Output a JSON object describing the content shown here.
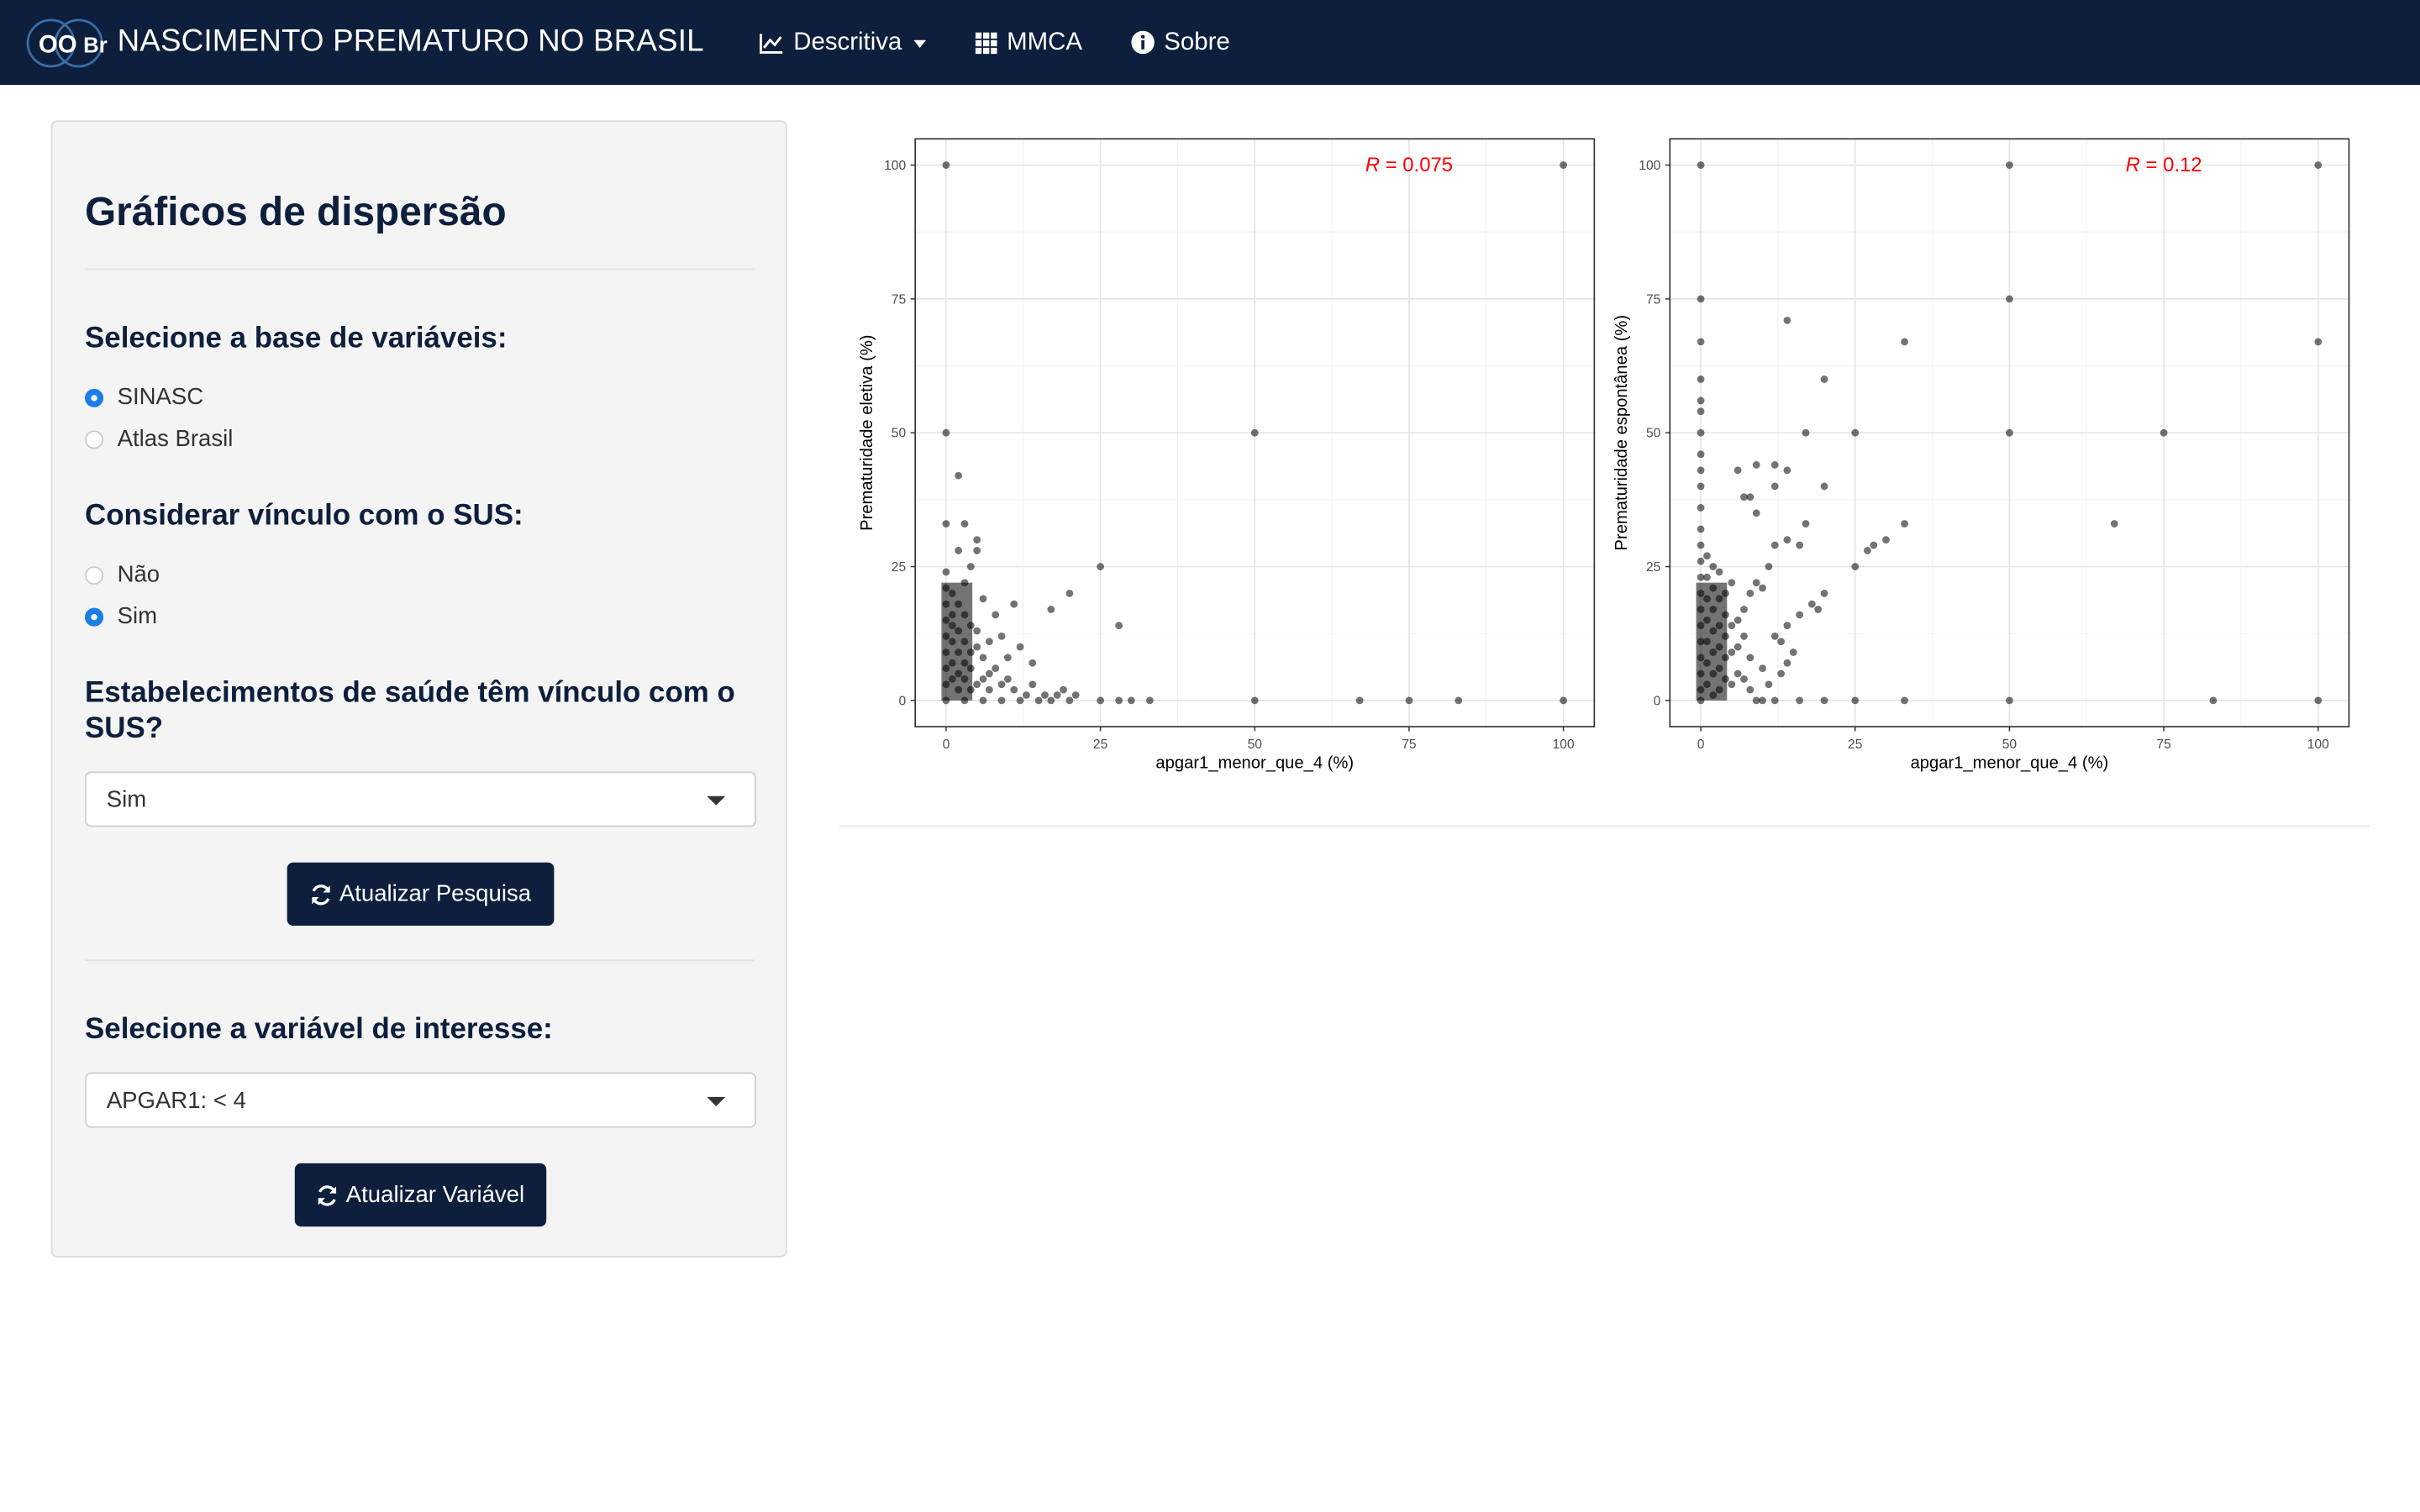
{
  "navbar": {
    "logo_text": "OOBr",
    "title": "NASCIMENTO PREMATURO NO BRASIL",
    "items": [
      {
        "label": "Descritiva",
        "icon": "line-chart-icon",
        "dropdown": true
      },
      {
        "label": "MMCA",
        "icon": "grid-icon",
        "dropdown": false
      },
      {
        "label": "Sobre",
        "icon": "info-circle-icon",
        "dropdown": false
      }
    ]
  },
  "sidebar": {
    "title": "Gráficos de dispersão",
    "base_label": "Selecione a base de variáveis:",
    "base_options": [
      {
        "label": "SINASC",
        "selected": true
      },
      {
        "label": "Atlas Brasil",
        "selected": false
      }
    ],
    "sus_label": "Considerar vínculo com o SUS:",
    "sus_options": [
      {
        "label": "Não",
        "selected": false
      },
      {
        "label": "Sim",
        "selected": true
      }
    ],
    "estab_label": "Estabelecimentos de saúde têm vínculo com o SUS?",
    "estab_value": "Sim",
    "update_search_label": "Atualizar Pesquisa",
    "variable_label": "Selecione a variável de interesse:",
    "variable_value": "APGAR1: < 4",
    "update_variable_label": "Atualizar Variável"
  },
  "colors": {
    "navbar_bg": "#0d1f3c",
    "button_bg": "#0d1f3c",
    "radio_selected": "#1a7ee6",
    "annotation": "#ff0000"
  },
  "chart_data": [
    {
      "type": "scatter",
      "xlabel": "apgar1_menor_que_4 (%)",
      "ylabel": "Prematuridade eletiva (%)",
      "xlim": [
        0,
        100
      ],
      "ylim": [
        0,
        100
      ],
      "xticks": [
        0,
        25,
        50,
        75,
        100
      ],
      "yticks": [
        0,
        25,
        50,
        75,
        100
      ],
      "annotation": {
        "var": "R",
        "text": " = 0.075"
      },
      "grid": true,
      "points": [
        [
          0,
          100
        ],
        [
          100,
          100
        ],
        [
          0,
          50
        ],
        [
          50,
          50
        ],
        [
          0,
          33
        ],
        [
          5,
          30
        ],
        [
          5,
          28
        ],
        [
          2,
          42
        ],
        [
          3,
          33
        ],
        [
          2,
          28
        ],
        [
          25,
          25
        ],
        [
          20,
          20
        ],
        [
          17,
          17
        ],
        [
          28,
          14
        ],
        [
          4,
          25
        ],
        [
          3,
          22
        ],
        [
          6,
          19
        ],
        [
          8,
          16
        ],
        [
          11,
          18
        ],
        [
          9,
          12
        ],
        [
          12,
          10
        ],
        [
          14,
          7
        ],
        [
          19,
          2
        ],
        [
          7,
          5
        ],
        [
          10,
          4
        ],
        [
          5,
          13
        ],
        [
          4,
          9
        ],
        [
          1,
          14
        ],
        [
          0,
          0
        ],
        [
          3,
          0
        ],
        [
          6,
          0
        ],
        [
          9,
          0
        ],
        [
          12,
          0
        ],
        [
          15,
          0
        ],
        [
          17,
          0
        ],
        [
          20,
          0
        ],
        [
          25,
          0
        ],
        [
          28,
          0
        ],
        [
          30,
          0
        ],
        [
          33,
          0
        ],
        [
          50,
          0
        ],
        [
          67,
          0
        ],
        [
          75,
          0
        ],
        [
          83,
          0
        ],
        [
          100,
          0
        ],
        [
          0,
          24
        ],
        [
          0,
          21
        ],
        [
          0,
          18
        ],
        [
          0,
          15
        ],
        [
          0,
          12
        ],
        [
          0,
          9
        ],
        [
          0,
          6
        ],
        [
          0,
          3
        ],
        [
          1,
          20
        ],
        [
          1,
          16
        ],
        [
          1,
          11
        ],
        [
          1,
          7
        ],
        [
          1,
          4
        ],
        [
          2,
          18
        ],
        [
          2,
          13
        ],
        [
          2,
          9
        ],
        [
          2,
          5
        ],
        [
          2,
          2
        ],
        [
          3,
          16
        ],
        [
          3,
          11
        ],
        [
          3,
          7
        ],
        [
          3,
          4
        ],
        [
          4,
          14
        ],
        [
          4,
          6
        ],
        [
          4,
          2
        ],
        [
          5,
          10
        ],
        [
          5,
          3
        ],
        [
          6,
          8
        ],
        [
          6,
          4
        ],
        [
          7,
          11
        ],
        [
          7,
          2
        ],
        [
          8,
          6
        ],
        [
          9,
          3
        ],
        [
          10,
          8
        ],
        [
          11,
          2
        ],
        [
          13,
          1
        ],
        [
          14,
          3
        ],
        [
          16,
          1
        ],
        [
          18,
          1
        ],
        [
          21,
          1
        ]
      ]
    },
    {
      "type": "scatter",
      "xlabel": "apgar1_menor_que_4 (%)",
      "ylabel": "Prematuridade espontânea (%)",
      "xlim": [
        0,
        100
      ],
      "ylim": [
        0,
        100
      ],
      "xticks": [
        0,
        25,
        50,
        75,
        100
      ],
      "yticks": [
        0,
        25,
        50,
        75,
        100
      ],
      "annotation": {
        "var": "R",
        "text": " = 0.12"
      },
      "grid": true,
      "points": [
        [
          0,
          100
        ],
        [
          50,
          100
        ],
        [
          100,
          100
        ],
        [
          0,
          75
        ],
        [
          50,
          75
        ],
        [
          0,
          67
        ],
        [
          33,
          67
        ],
        [
          100,
          67
        ],
        [
          14,
          71
        ],
        [
          20,
          60
        ],
        [
          0,
          60
        ],
        [
          0,
          56
        ],
        [
          0,
          54
        ],
        [
          17,
          50
        ],
        [
          25,
          50
        ],
        [
          50,
          50
        ],
        [
          75,
          50
        ],
        [
          0,
          50
        ],
        [
          0,
          46
        ],
        [
          0,
          43
        ],
        [
          6,
          43
        ],
        [
          9,
          44
        ],
        [
          12,
          44
        ],
        [
          14,
          43
        ],
        [
          20,
          40
        ],
        [
          12,
          40
        ],
        [
          7,
          38
        ],
        [
          8,
          38
        ],
        [
          0,
          40
        ],
        [
          0,
          36
        ],
        [
          9,
          35
        ],
        [
          33,
          33
        ],
        [
          67,
          33
        ],
        [
          17,
          33
        ],
        [
          30,
          30
        ],
        [
          28,
          29
        ],
        [
          27,
          28
        ],
        [
          14,
          30
        ],
        [
          12,
          29
        ],
        [
          16,
          29
        ],
        [
          25,
          25
        ],
        [
          18,
          18
        ],
        [
          19,
          17
        ],
        [
          20,
          20
        ],
        [
          16,
          16
        ],
        [
          14,
          14
        ],
        [
          15,
          9
        ],
        [
          12,
          12
        ],
        [
          13,
          11
        ],
        [
          14,
          7
        ],
        [
          11,
          25
        ],
        [
          9,
          22
        ],
        [
          10,
          21
        ],
        [
          8,
          20
        ],
        [
          7,
          17
        ],
        [
          6,
          15
        ],
        [
          0,
          0
        ],
        [
          9,
          0
        ],
        [
          10,
          0
        ],
        [
          12,
          0
        ],
        [
          16,
          0
        ],
        [
          20,
          0
        ],
        [
          25,
          0
        ],
        [
          33,
          0
        ],
        [
          50,
          0
        ],
        [
          83,
          0
        ],
        [
          100,
          0
        ],
        [
          0,
          32
        ],
        [
          0,
          29
        ],
        [
          0,
          26
        ],
        [
          0,
          23
        ],
        [
          0,
          20
        ],
        [
          0,
          17
        ],
        [
          0,
          14
        ],
        [
          0,
          11
        ],
        [
          0,
          8
        ],
        [
          0,
          5
        ],
        [
          0,
          2
        ],
        [
          1,
          27
        ],
        [
          1,
          23
        ],
        [
          1,
          19
        ],
        [
          1,
          15
        ],
        [
          1,
          11
        ],
        [
          1,
          7
        ],
        [
          1,
          3
        ],
        [
          2,
          25
        ],
        [
          2,
          21
        ],
        [
          2,
          17
        ],
        [
          2,
          13
        ],
        [
          2,
          9
        ],
        [
          2,
          5
        ],
        [
          2,
          1
        ],
        [
          3,
          24
        ],
        [
          3,
          19
        ],
        [
          3,
          14
        ],
        [
          3,
          10
        ],
        [
          3,
          6
        ],
        [
          3,
          2
        ],
        [
          4,
          20
        ],
        [
          4,
          16
        ],
        [
          4,
          12
        ],
        [
          4,
          8
        ],
        [
          4,
          4
        ],
        [
          5,
          22
        ],
        [
          5,
          14
        ],
        [
          5,
          9
        ],
        [
          5,
          3
        ],
        [
          6,
          10
        ],
        [
          6,
          5
        ],
        [
          7,
          12
        ],
        [
          7,
          4
        ],
        [
          8,
          8
        ],
        [
          8,
          2
        ],
        [
          10,
          6
        ],
        [
          11,
          3
        ],
        [
          13,
          5
        ]
      ]
    }
  ]
}
